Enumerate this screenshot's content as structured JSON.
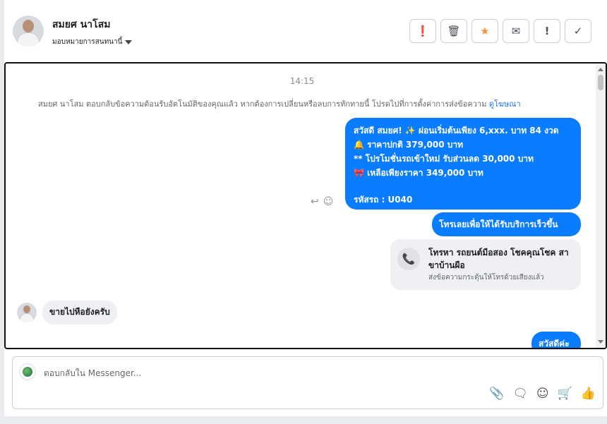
{
  "header": {
    "name": "สมยศ นาโสม",
    "assign_label": "มอบหมายการสนทนานี้",
    "tools": [
      {
        "icon": "alert-circle-icon",
        "glyph": "❗"
      },
      {
        "icon": "trash-icon",
        "glyph": "🗑"
      },
      {
        "icon": "star-icon",
        "glyph": "★"
      },
      {
        "icon": "mail-icon",
        "glyph": "✉"
      },
      {
        "icon": "exclamation-icon",
        "glyph": "!"
      },
      {
        "icon": "check-icon",
        "glyph": "✓"
      }
    ],
    "star_color": "#f7923b"
  },
  "conversation": {
    "time": "14:15",
    "notice": "สมยศ นาโสม ตอบกลับข้อความต้อนรับอัตโนมัติของคุณแล้ว หากต้องการเปลี่ยนหรือลบการทักทายนี้ โปรดไปที่การตั้งค่าการส่งข้อความ",
    "notice_link": "ดูโฆษณา",
    "message_promo": {
      "line1": "สวัสดี สมยศ! ✨  ผ่อนเริ่มต้นเพียง 6,xxx. บาท 84 งวด",
      "line2": "🔔 ราคาปกติ 379,000 บาท",
      "line3": "** โปรโมชั่นรถเข้าใหม่ รับส่วนลด 30,000 บาท",
      "line4": "🎀  เหลือเพียงราคา 349,000 บาท",
      "code": "รหัสรถ : U040"
    },
    "message_call_cta": "โทรเลยเพื่อให้ได้รับบริการเร็วขึ้น",
    "call_card": {
      "title": "โทรหา รถยนต์มือสอง โชคคุณโชค สาขาบ้านผือ",
      "subtitle": "ส่งข้อความกระตุ้นให้โทรด้วยเสียงแล้ว"
    },
    "incoming_message": "ขายไปหือยังครับ",
    "message_last": "สวัสดีค่ะ",
    "bubble_color": "#0a7cff"
  },
  "composer": {
    "placeholder": "ตอบกลับใน Messenger..."
  }
}
